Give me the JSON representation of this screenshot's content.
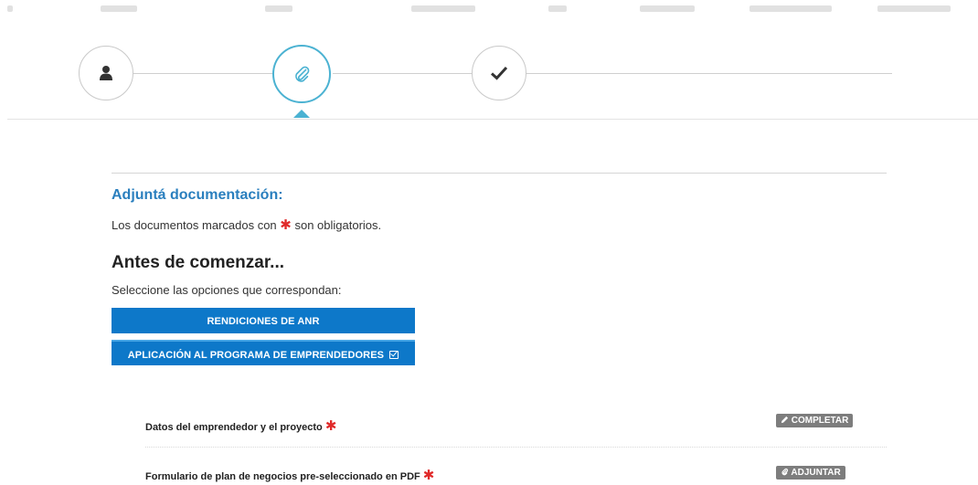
{
  "stepper": {
    "steps": [
      {
        "icon": "user-icon",
        "state": "done"
      },
      {
        "icon": "paperclip-icon",
        "state": "active"
      },
      {
        "icon": "check-icon",
        "state": "pending"
      }
    ]
  },
  "main": {
    "section_title": "Adjuntá documentación:",
    "required_note_before": "Los documentos marcados con",
    "required_marker": "✱",
    "required_note_after": "son obligatorios.",
    "before_title": "Antes de comenzar...",
    "select_hint": "Seleccione las opciones que correspondan:",
    "options": [
      {
        "label": "RENDICIONES DE ANR",
        "selected": false
      },
      {
        "label": "APLICACIÓN AL PROGRAMA DE EMPRENDEDORES",
        "selected": true
      }
    ],
    "documents": [
      {
        "label": "Datos del emprendedor y el proyecto",
        "required": true,
        "action": "COMPLETAR",
        "action_icon": "pencil-icon"
      },
      {
        "label": "Formulario de plan de negocios pre-seleccionado en PDF",
        "required": true,
        "action": "ADJUNTAR",
        "action_icon": "paperclip-icon"
      }
    ]
  },
  "colors": {
    "accent": "#4bb2d2",
    "primary_button": "#0d78c9",
    "title": "#2a7fbe",
    "required": "#e02a2a",
    "action_button": "#7d7d7d"
  }
}
